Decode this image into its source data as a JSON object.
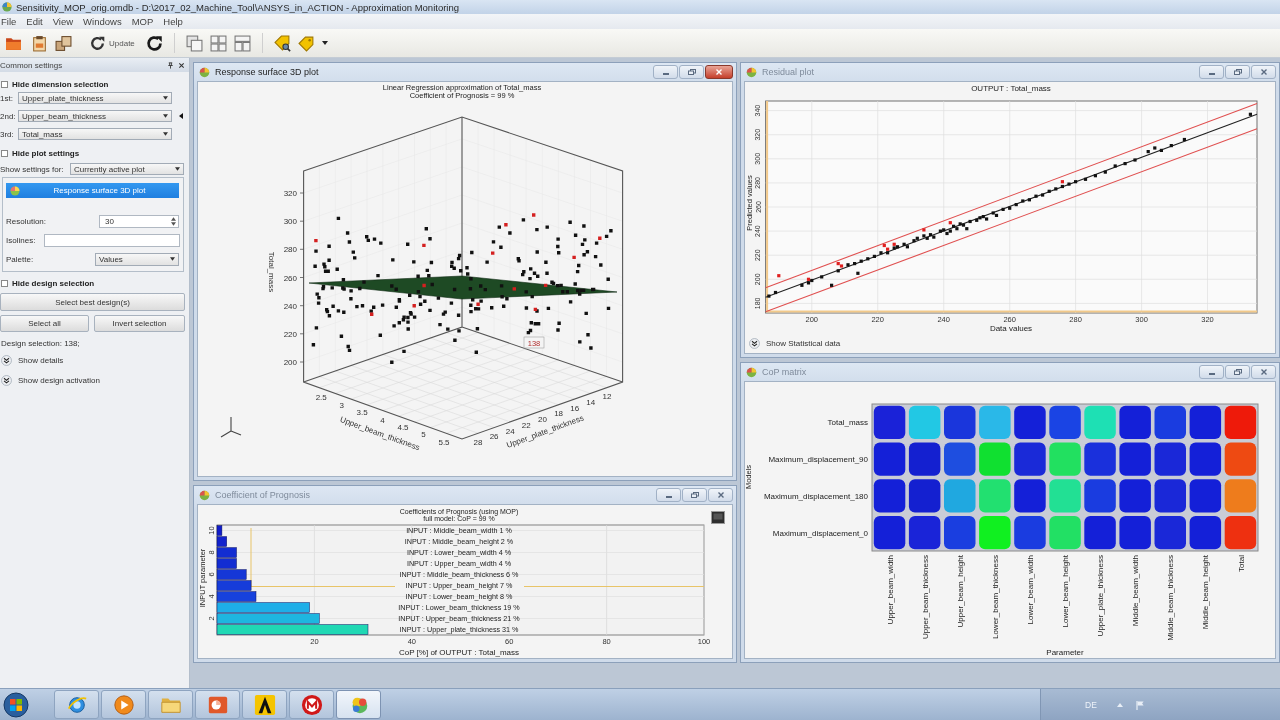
{
  "window": {
    "title": "Sensitivity_MOP_orig.omdb - D:\\2017_02_Machine_Tool\\ANSYS_in_ACTION - Approximation Monitoring"
  },
  "menu": [
    "File",
    "Edit",
    "View",
    "Windows",
    "MOP",
    "Help"
  ],
  "toolbar": {
    "update_label": "Update"
  },
  "settings_panel": {
    "title": "Common settings",
    "dimension_section": {
      "heading": "Hide dimension selection",
      "rows": [
        {
          "label": "1st:",
          "value": "Upper_plate_thickness",
          "selected": false
        },
        {
          "label": "2nd:",
          "value": "Upper_beam_thickness",
          "selected": true
        },
        {
          "label": "3rd:",
          "value": "Total_mass",
          "selected": false
        }
      ]
    },
    "plot_section": {
      "heading": "Hide plot settings",
      "settings_for": {
        "label": "Show settings for:",
        "value": "Currently active plot"
      },
      "plot_name": "Response surface 3D plot",
      "resolution": {
        "label": "Resolution:",
        "value": "30"
      },
      "isolines": {
        "label": "Isolines:"
      },
      "palette": {
        "label": "Palette:",
        "value": "Values"
      }
    },
    "design_section": {
      "heading": "Hide design selection",
      "best_button": "Select best design(s)",
      "select_all_button": "Select all",
      "invert_button": "Invert selection",
      "selection_text": "Design selection: 138;",
      "expanders": [
        {
          "label": "Show details",
          "expanded": false
        },
        {
          "label": "Show design activation",
          "expanded": false
        }
      ]
    }
  },
  "surface_window": {
    "title": "Response surface 3D plot",
    "active": true,
    "plot": {
      "title_lines": [
        "Linear Regression approximation of Total_mass",
        "Coefficient of Prognosis = 99 %"
      ],
      "z_label": "Total_mass",
      "z_ticks": [
        "320",
        "300",
        "280",
        "260",
        "240",
        "220",
        "200"
      ],
      "x_label": "Upper_beam_thickness",
      "x_ticks": [
        "2.5",
        "3",
        "3.5",
        "4",
        "4.5",
        "5",
        "5.5"
      ],
      "y_label": "Upper_plate_thickness",
      "y_ticks": [
        "28",
        "26",
        "24",
        "22",
        "20",
        "18",
        "16",
        "14",
        "12"
      ],
      "point_label": "138"
    }
  },
  "residual_window": {
    "title": "Residual plot",
    "active": false,
    "chart_data": {
      "type": "scatter",
      "title": "OUTPUT : Total_mass",
      "xlabel": "Data values",
      "ylabel": "Predicted values",
      "grid": true,
      "xlim": [
        186,
        335
      ],
      "ylim": [
        172,
        348
      ],
      "xticks": [
        200,
        220,
        240,
        260,
        280,
        300,
        320
      ],
      "yticks": [
        180,
        200,
        220,
        240,
        260,
        280,
        300,
        320,
        340
      ],
      "series": [
        {
          "type": "line",
          "color": "#e05050",
          "x": [
            186,
            335
          ],
          "values": [
            193,
            346
          ]
        },
        {
          "type": "line",
          "color": "#222222",
          "x": [
            186,
            335
          ],
          "values": [
            185,
            337
          ]
        },
        {
          "type": "line",
          "color": "#e05050",
          "x": [
            186,
            335
          ],
          "values": [
            173,
            325
          ]
        },
        {
          "color": "#111111",
          "x": [
            187,
            189,
            197,
            199,
            200,
            203,
            206,
            208,
            211,
            213,
            214,
            215,
            217,
            219,
            221,
            223,
            225,
            226,
            228,
            229,
            231,
            232,
            234,
            235,
            236,
            237,
            239,
            240,
            241,
            242,
            243,
            244,
            245,
            246,
            247,
            248,
            250,
            251,
            252,
            253,
            255,
            256,
            258,
            260,
            262,
            264,
            266,
            268,
            270,
            272,
            274,
            276,
            278,
            280,
            283,
            286,
            289,
            292,
            295,
            298,
            302,
            304,
            306,
            309,
            313,
            333
          ],
          "values": [
            186,
            189,
            195,
            197,
            199,
            202,
            195,
            207,
            212,
            213,
            205,
            215,
            217,
            219,
            222,
            222,
            226,
            227,
            229,
            227,
            232,
            234,
            236,
            234,
            237,
            235,
            240,
            241,
            238,
            240,
            244,
            242,
            246,
            245,
            242,
            248,
            249,
            251,
            252,
            250,
            255,
            253,
            258,
            259,
            262,
            265,
            266,
            269,
            270,
            273,
            275,
            277,
            279,
            281,
            283,
            286,
            289,
            294,
            296,
            299,
            306,
            309,
            307,
            311,
            316,
            337
          ]
        },
        {
          "color": "#e02020",
          "x": [
            190,
            199,
            208,
            209,
            222,
            223,
            225,
            234,
            242,
            276
          ],
          "values": [
            203,
            200,
            213,
            211,
            228,
            225,
            229,
            241,
            247,
            281
          ]
        }
      ]
    },
    "footer": {
      "label": "Show Statistical data",
      "expanded": false
    }
  },
  "matrix_window": {
    "title": "CoP matrix",
    "active": false,
    "matrix": {
      "ylabel": "Models",
      "xlabel": "Parameter",
      "columns": [
        "Upper_beam_width",
        "Upper_beam_thickness",
        "Upper_beam_height",
        "Lower_beam_thickness",
        "Lower_beam_width",
        "Lower_beam_height",
        "Upper_plate_thickness",
        "Middle_beam_width",
        "Middle_beam_thickness",
        "Middle_beam_height",
        "Total"
      ],
      "rows": [
        {
          "label": "Total_mass",
          "cells": [
            {
              "color": "#1a22d8"
            },
            {
              "color": "#22c8e4"
            },
            {
              "color": "#1a36dc"
            },
            {
              "color": "#2ab8e8"
            },
            {
              "color": "#1420d8"
            },
            {
              "color": "#1a44e4"
            },
            {
              "color": "#1ee0b4"
            },
            {
              "color": "#1420d8"
            },
            {
              "color": "#1a3ce0"
            },
            {
              "color": "#1420d8"
            },
            {
              "color": "#ee1a0a"
            }
          ]
        },
        {
          "label": "Maximum_displacement_90",
          "cells": [
            {
              "color": "#1420d8"
            },
            {
              "color": "#1420d0"
            },
            {
              "color": "#1e4ee0"
            },
            {
              "color": "#10e030"
            },
            {
              "color": "#1a2ad8"
            },
            {
              "color": "#22e060"
            },
            {
              "color": "#1a30dc"
            },
            {
              "color": "#1420d8"
            },
            {
              "color": "#1a28d8"
            },
            {
              "color": "#1420d8"
            },
            {
              "color": "#ee4a12"
            }
          ]
        },
        {
          "label": "Maximum_displacement_180",
          "cells": [
            {
              "color": "#1420d8"
            },
            {
              "color": "#1420d0"
            },
            {
              "color": "#20a8e0"
            },
            {
              "color": "#22e070"
            },
            {
              "color": "#1420d8"
            },
            {
              "color": "#22e094"
            },
            {
              "color": "#1a3ce0"
            },
            {
              "color": "#1420d8"
            },
            {
              "color": "#1a28d8"
            },
            {
              "color": "#1420d8"
            },
            {
              "color": "#ee7c1c"
            }
          ]
        },
        {
          "label": "Maximum_displacement_0",
          "cells": [
            {
              "color": "#1420d8"
            },
            {
              "color": "#1a24d8"
            },
            {
              "color": "#1a3ee0"
            },
            {
              "color": "#10f020"
            },
            {
              "color": "#1a3ce0"
            },
            {
              "color": "#22e064"
            },
            {
              "color": "#1420d8"
            },
            {
              "color": "#1420d8"
            },
            {
              "color": "#1a28d8"
            },
            {
              "color": "#1420d8"
            },
            {
              "color": "#ee3010"
            }
          ]
        }
      ]
    }
  },
  "cop_window": {
    "title": "Coefficient of Prognosis",
    "active": false,
    "chart_data": {
      "type": "bar",
      "orientation": "horizontal",
      "title": "Coefficients of Prognosis (using MOP)",
      "subtitle": "full model: CoP = 99 %",
      "xlabel": "CoP [%] of OUTPUT : Total_mass",
      "ylabel": "INPUT parameter",
      "grid": true,
      "xlim": [
        0,
        100
      ],
      "xticks": [
        20,
        40,
        60,
        80,
        100
      ],
      "ylim": [
        0.5,
        10.5
      ],
      "yticks": [
        2,
        4,
        6,
        8,
        10
      ],
      "x": [
        10,
        9,
        8,
        7,
        6,
        5,
        4,
        3,
        2,
        1
      ],
      "values": [
        1,
        2,
        4,
        4,
        6,
        7,
        8,
        19,
        21,
        31
      ],
      "annotations": [
        "INPUT : Middle_beam_width 1 %",
        "INPUT : Middle_beam_height 2 %",
        "INPUT : Lower_beam_width 4 %",
        "INPUT : Upper_beam_width 4 %",
        "INPUT : Middle_beam_thickness 6 %",
        "INPUT : Upper_beam_height 7 %",
        "INPUT : Lower_beam_height 8 %",
        "INPUT : Lower_beam_thickness 19 %",
        "INPUT : Upper_beam_thickness 21 %",
        "INPUT : Upper_plate_thickness 31 %"
      ]
    }
  },
  "taskbar": {
    "apps": [
      {
        "running": true,
        "selected": false
      },
      {
        "running": true,
        "selected": false
      },
      {
        "running": true,
        "selected": false
      },
      {
        "running": true,
        "selected": false
      },
      {
        "running": true,
        "selected": false
      },
      {
        "running": true,
        "selected": false
      },
      {
        "running": true,
        "selected": true
      }
    ],
    "tray_text": "DE"
  }
}
